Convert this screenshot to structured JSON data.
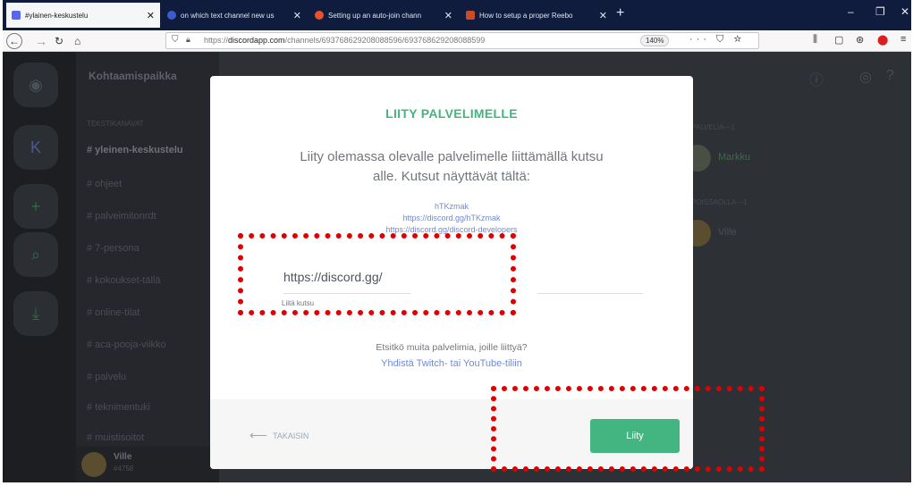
{
  "browser": {
    "tabs": [
      {
        "title": "#ylainen-keskustelu",
        "color": "#5865f2",
        "active": true
      },
      {
        "title": "on which text channel new us",
        "color": "#3b5ccc"
      },
      {
        "title": "Setting up an auto-join chann",
        "color": "#e8522a"
      },
      {
        "title": "How to setup a proper Reebo",
        "color": "#c94b2a"
      }
    ],
    "url_prefix": "https://",
    "url_domain": "discordapp.com",
    "url_path": "/channels/693768629208088596/693768629208088599",
    "zoom": "140%",
    "url_icons": "··· ⛉ ☆"
  },
  "discord": {
    "server_name": "Kohtaamispaikka",
    "channel_header": "TEKSTIKANAVAT",
    "channels": [
      "# yleinen-keskustelu",
      "# ohjeet",
      "# palveimitonrdt",
      "# 7-persona",
      "# kokoukset-tällä",
      "# online-tilat",
      "# aca-pooja-viikko",
      "# palvelu",
      "# teknimentuki",
      "# muistisoitot"
    ],
    "user_name": "Ville",
    "user_tag": "#4758",
    "member_header_1": "PALVELIA—1",
    "member_header_2": "POISSAOLLA—1",
    "member_1": "Markku",
    "member_2": "Ville",
    "guild_initial": "K"
  },
  "modal": {
    "title": "LIITY PALVELIMELLE",
    "description": "Liity olemassa olevalle palvelimelle liittämällä kutsu alle. Kutsut näyttävät tältä:",
    "examples": [
      "hTKzmak",
      "https://discord.gg/hTKzmak",
      "https://discord.gg/discord-developers"
    ],
    "invite_value": "https://discord.gg/",
    "invite_hint": "Liitä kutsu",
    "question": "Etsitkö muita palvelimia, joille liittyä?",
    "link": "Yhdistä Twitch- tai YouTube-tiliin",
    "back_label": "TAKAISIN",
    "join_label": "Liity"
  },
  "colors": {
    "accent_green": "#43b581",
    "link_blue": "#7289da",
    "highlight_red": "#e00000"
  }
}
